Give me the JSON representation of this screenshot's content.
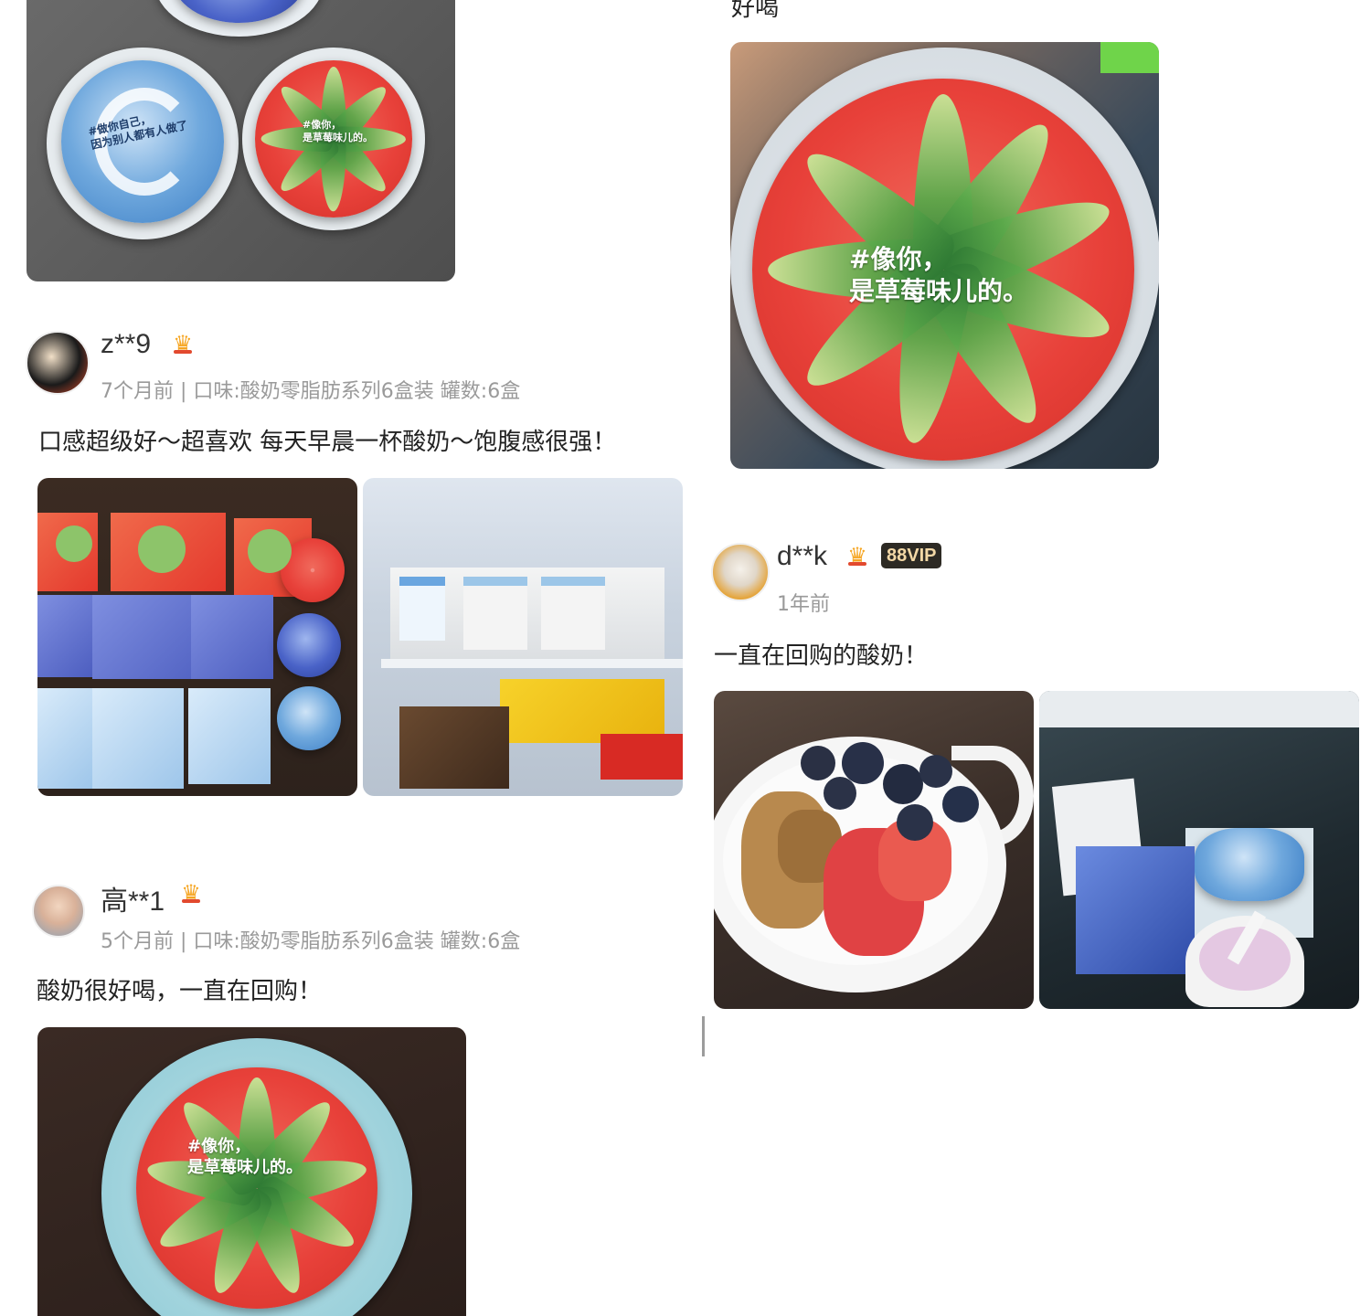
{
  "prev_review": {
    "text_tail": "好喝",
    "lid_caption_line1": "#像你，",
    "lid_caption_line2": "是草莓味儿的。",
    "small_lid_blue_caption1": "#做你自己，",
    "small_lid_blue_caption2": "因为别人都有人做了",
    "small_lid_red_caption1": "#像你，",
    "small_lid_red_caption2": "是草莓味儿的。"
  },
  "reviews": [
    {
      "username": "z**9",
      "meta": "7个月前 | 口味:酸奶零脂肪系列6盒装 罐数:6盒",
      "text": "口感超级好～超喜欢 每天早晨一杯酸奶～饱腹感很强！"
    },
    {
      "username": "高**1",
      "meta": "5个月前 | 口味:酸奶零脂肪系列6盒装 罐数:6盒",
      "text": "酸奶很好喝，一直在回购！",
      "lid_caption_line1": "#像你，",
      "lid_caption_line2": "是草莓味儿的。"
    },
    {
      "username": "d**k",
      "vip": "88VIP",
      "meta": "1年前",
      "text": "一直在回购的酸奶！"
    }
  ],
  "colors": {
    "username": "#333333",
    "meta": "#9a9a9a",
    "crown": "#f6a623",
    "vip_bg": "#2d2a24",
    "vip_text": "#f3d8a6"
  },
  "icons": [
    "crown-icon",
    "avatar"
  ]
}
